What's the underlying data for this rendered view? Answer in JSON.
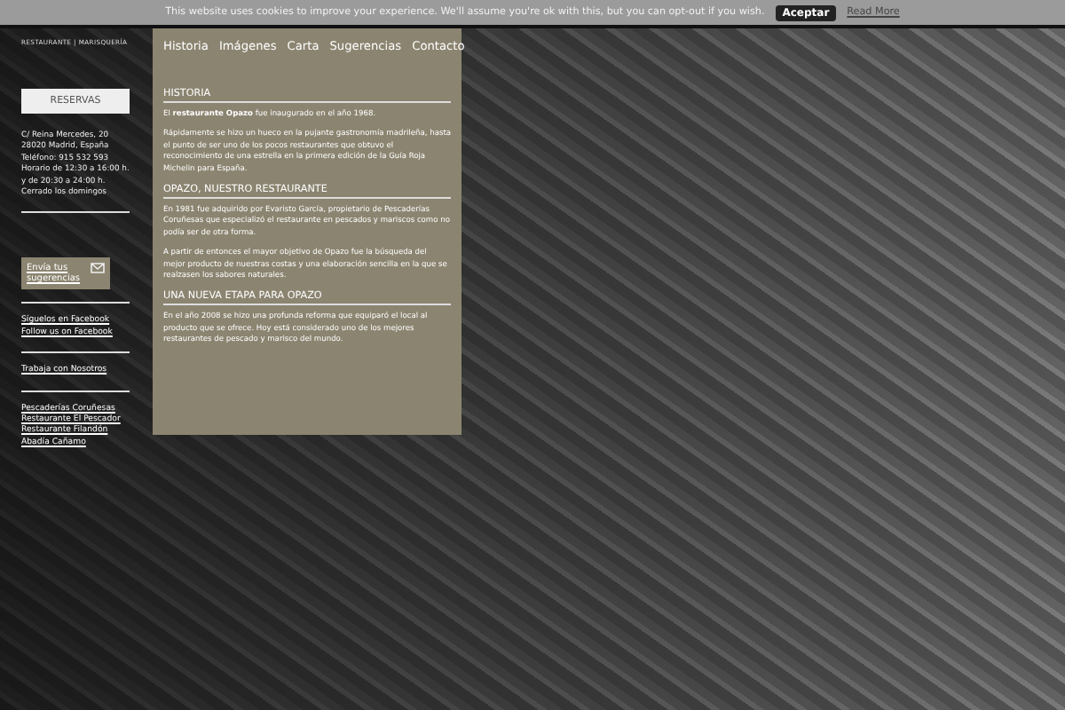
{
  "cookie_banner": {
    "text": "This website uses cookies to improve your experience. We'll assume you're ok with this, but you can opt-out if you wish.",
    "accept": "Aceptar",
    "read_more": "Read More"
  },
  "sidebar": {
    "tagline": "RESTAURANTE | MARISQUERÍA",
    "reserve_button": "RESERVAS",
    "address": [
      "C/ Reina Mercedes, 20",
      "28020 Madrid, España",
      "Teléfono: 915 532 593",
      "Horario de 12:30 a 16:00 h.",
      "y de 20:30 a 24:00 h.",
      "Cerrado los domingos"
    ],
    "suggest_button": "Envía tus sugerencias",
    "link_groups": [
      [
        "Síguelos en Facebook",
        "Follow us on Facebook"
      ],
      [
        "Trabaja con Nosotros"
      ],
      [
        "Pescaderías Coruñesas",
        "Restaurante El Pescador",
        "Restaurante Filandón",
        "Abadía Cañamo"
      ]
    ]
  },
  "nav": [
    {
      "label": "Historia"
    },
    {
      "label": "Imágenes"
    },
    {
      "label": "Carta"
    },
    {
      "label": "Sugerencias"
    },
    {
      "label": "Contacto"
    }
  ],
  "sections": [
    {
      "heading": "HISTORIA",
      "paragraphs": [
        "El **restaurante Opazo** fue inaugurado en el año 1968.",
        "Rápidamente se hizo un hueco en la pujante gastronomía madrileña, hasta el punto de ser uno de los pocos restaurantes que obtuvo el reconocimiento de una estrella en la primera edición de la Guía Roja Michelin para España."
      ]
    },
    {
      "heading": "OPAZO, NUESTRO RESTAURANTE",
      "paragraphs": [
        "En 1981 fue adquirido por Evaristo García, propietario de Pescaderías Coruñesas que especializó el restaurante en pescados y mariscos como no podía ser de otra forma.",
        "A partir de entonces el mayor objetivo de Opazo fue la búsqueda del mejor producto de nuestras costas y una elaboración sencilla en la que se realzasen los sabores naturales."
      ]
    },
    {
      "heading": "UNA NUEVA ETAPA PARA OPAZO",
      "paragraphs": [
        "En el año 2008 se hizo una profunda reforma que equiparó el local al producto que se ofrece. Hoy está considerado uno de los mejores restaurantes de pescado y marisco del mundo."
      ]
    }
  ]
}
